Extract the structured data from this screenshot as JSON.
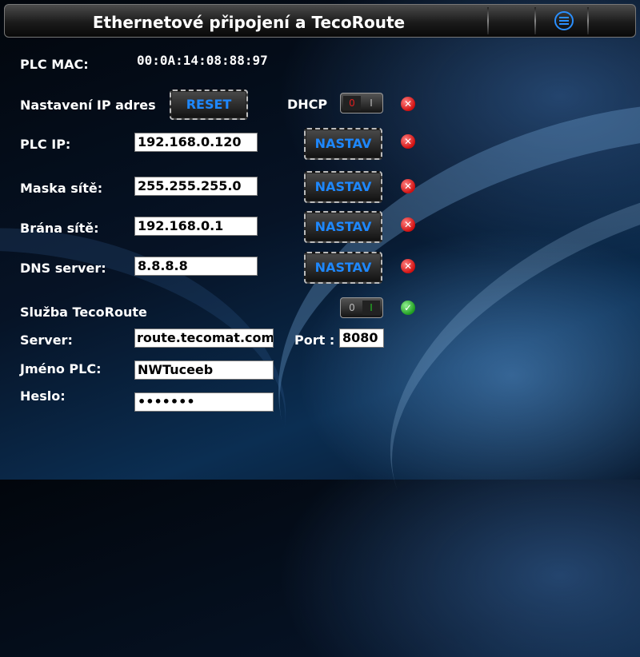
{
  "header": {
    "title": "Ethernetové připojení a TecoRoute",
    "menu_icon": "menu-icon"
  },
  "mac": {
    "label": "PLC MAC:",
    "value": "00:0A:14:08:88:97"
  },
  "ip_settings": {
    "label": "Nastavení IP adres",
    "reset_label": "RESET",
    "dhcp_label": "DHCP",
    "dhcp_toggle": {
      "off": "0",
      "on": "I",
      "state": "off"
    },
    "dhcp_status": "error"
  },
  "network": [
    {
      "key": "plc-ip",
      "label": "PLC IP:",
      "value": "192.168.0.120",
      "button": "NASTAV",
      "status": "error"
    },
    {
      "key": "mask",
      "label": "Maska sítě:",
      "value": "255.255.255.0",
      "button": "NASTAV",
      "status": "error"
    },
    {
      "key": "gateway",
      "label": "Brána sítě:",
      "value": "192.168.0.1",
      "button": "NASTAV",
      "status": "error"
    },
    {
      "key": "dns",
      "label": "DNS server:",
      "value": "8.8.8.8",
      "button": "NASTAV",
      "status": "error"
    }
  ],
  "tecoroute": {
    "label": "Služba TecoRoute",
    "toggle": {
      "off": "0",
      "on": "I",
      "state": "on"
    },
    "status": "ok",
    "server_label": "Server:",
    "server_value": "route.tecomat.com",
    "port_label": "Port :",
    "port_value": "8080",
    "name_label": "Jméno PLC:",
    "name_value": "NWTuceeb",
    "password_label": "Heslo:",
    "password_value": "•••••••"
  },
  "colors": {
    "accent": "#1e88ff",
    "error": "#d10f0f",
    "ok": "#1f9d1f",
    "toggle_off": "#e02020",
    "toggle_on": "#22c022"
  }
}
